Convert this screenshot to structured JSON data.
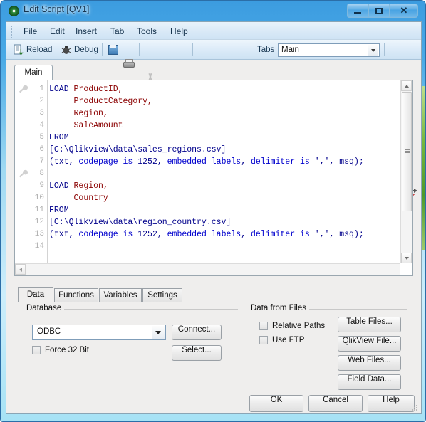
{
  "window": {
    "title": "Edit Script [QV1]",
    "icon": "qlikview-logo-icon",
    "minimize_label": "Minimize",
    "maximize_label": "Maximize",
    "close_label": "Close"
  },
  "menubar": {
    "items": [
      {
        "label": "File"
      },
      {
        "label": "Edit"
      },
      {
        "label": "Insert"
      },
      {
        "label": "Tab"
      },
      {
        "label": "Tools"
      },
      {
        "label": "Help"
      }
    ]
  },
  "toolbar": {
    "reload_label": "Reload",
    "debug_label": "Debug",
    "tabs_label": "Tabs",
    "tabs_selected": "Main",
    "icons": [
      "save-icon",
      "print-icon",
      "cut-icon",
      "copy-icon",
      "paste-icon",
      "search-icon",
      "open-folder-icon",
      "previous-tab-icon",
      "next-tab-icon",
      "table-structure-icon",
      "auto-complete-icon"
    ]
  },
  "editor": {
    "tab_label": "Main",
    "lines": [
      {
        "n": "1",
        "tokens": [
          {
            "t": "LOAD",
            "c": "kw"
          },
          {
            "t": " ",
            "c": "plain"
          },
          {
            "t": "ProductID,",
            "c": "fld"
          }
        ]
      },
      {
        "n": "2",
        "tokens": [
          {
            "t": "     ",
            "c": "plain"
          },
          {
            "t": "ProductCategory,",
            "c": "fld"
          }
        ]
      },
      {
        "n": "3",
        "tokens": [
          {
            "t": "     ",
            "c": "plain"
          },
          {
            "t": "Region,",
            "c": "fld"
          }
        ]
      },
      {
        "n": "4",
        "tokens": [
          {
            "t": "     ",
            "c": "plain"
          },
          {
            "t": "SaleAmount",
            "c": "fld"
          }
        ]
      },
      {
        "n": "5",
        "tokens": [
          {
            "t": "FROM",
            "c": "kw"
          }
        ]
      },
      {
        "n": "6",
        "tokens": [
          {
            "t": "[C:\\Qlikview\\data\\sales_regions.csv]",
            "c": "plain"
          }
        ]
      },
      {
        "n": "7",
        "tokens": [
          {
            "t": "(txt, ",
            "c": "plain"
          },
          {
            "t": "codepage is",
            "c": "fn"
          },
          {
            "t": " 1252, ",
            "c": "plain"
          },
          {
            "t": "embedded labels",
            "c": "fn"
          },
          {
            "t": ", ",
            "c": "plain"
          },
          {
            "t": "delimiter is",
            "c": "fn"
          },
          {
            "t": " ',', msq);",
            "c": "plain"
          }
        ]
      },
      {
        "n": "8",
        "tokens": [
          {
            "t": "",
            "c": "plain"
          }
        ]
      },
      {
        "n": "9",
        "tokens": [
          {
            "t": "LOAD",
            "c": "kw"
          },
          {
            "t": " ",
            "c": "plain"
          },
          {
            "t": "Region,",
            "c": "fld"
          }
        ]
      },
      {
        "n": "10",
        "tokens": [
          {
            "t": "     ",
            "c": "plain"
          },
          {
            "t": "Country",
            "c": "fld"
          }
        ]
      },
      {
        "n": "11",
        "tokens": [
          {
            "t": "FROM",
            "c": "kw"
          }
        ]
      },
      {
        "n": "12",
        "tokens": [
          {
            "t": "[C:\\Qlikview\\data\\region_country.csv]",
            "c": "plain"
          }
        ]
      },
      {
        "n": "13",
        "tokens": [
          {
            "t": "(txt, ",
            "c": "plain"
          },
          {
            "t": "codepage is",
            "c": "fn"
          },
          {
            "t": " 1252, ",
            "c": "plain"
          },
          {
            "t": "embedded labels",
            "c": "fn"
          },
          {
            "t": ", ",
            "c": "plain"
          },
          {
            "t": "delimiter is",
            "c": "fn"
          },
          {
            "t": " ',', msq);",
            "c": "plain"
          }
        ]
      },
      {
        "n": "14",
        "tokens": [
          {
            "t": "",
            "c": "plain"
          }
        ]
      }
    ],
    "bookmark_lines": [
      1,
      9
    ],
    "bookmark_icon": "wrench-icon"
  },
  "bottom_tabs": [
    {
      "label": "Data",
      "active": true
    },
    {
      "label": "Functions",
      "active": false
    },
    {
      "label": "Variables",
      "active": false
    },
    {
      "label": "Settings",
      "active": false
    }
  ],
  "database_panel": {
    "group_title": "Database",
    "source_selected": "ODBC",
    "force32_label": "Force 32 Bit",
    "force32_checked": false,
    "connect_label": "Connect...",
    "select_label": "Select..."
  },
  "files_panel": {
    "group_title": "Data from Files",
    "relative_paths_label": "Relative Paths",
    "relative_paths_checked": false,
    "use_ftp_label": "Use FTP",
    "use_ftp_checked": false,
    "buttons": [
      {
        "label": "Table Files..."
      },
      {
        "label": "QlikView File..."
      },
      {
        "label": "Web Files..."
      },
      {
        "label": "Field Data..."
      }
    ]
  },
  "footer": {
    "ok_label": "OK",
    "cancel_label": "Cancel",
    "help_label": "Help"
  },
  "colors": {
    "keyword": "#00008B",
    "field": "#8B0000",
    "function": "#0000CD",
    "title_text": "#16334d",
    "dialog_bg": "#efeeed",
    "frame_accent": "#4aaae6"
  }
}
